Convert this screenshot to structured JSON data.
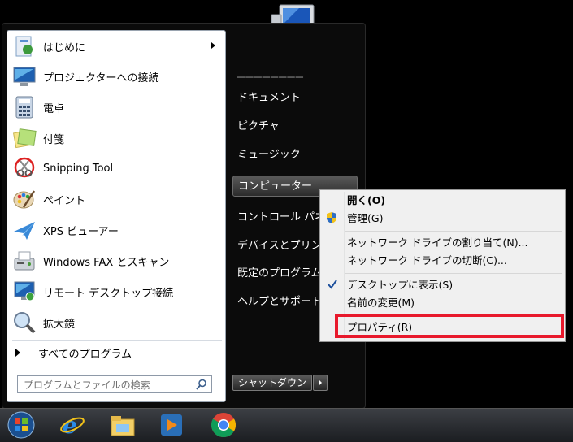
{
  "start_menu": {
    "programs": [
      {
        "label": "はじめに",
        "icon": "getting-started-icon",
        "submenu": true
      },
      {
        "label": "プロジェクターへの接続",
        "icon": "projector-icon"
      },
      {
        "label": "電卓",
        "icon": "calculator-icon"
      },
      {
        "label": "付箋",
        "icon": "sticky-notes-icon"
      },
      {
        "label": "Snipping Tool",
        "icon": "snipping-tool-icon"
      },
      {
        "label": "ペイント",
        "icon": "paint-palette-icon"
      },
      {
        "label": "XPS ビューアー",
        "icon": "xps-viewer-icon"
      },
      {
        "label": "Windows FAX とスキャン",
        "icon": "fax-scan-icon"
      },
      {
        "label": "リモート デスクトップ接続",
        "icon": "remote-desktop-icon"
      },
      {
        "label": "拡大鏡",
        "icon": "magnifier-icon"
      }
    ],
    "all_programs": "すべてのプログラム",
    "search_placeholder": "プログラムとファイルの検索",
    "right_pane": [
      "ドキュメント",
      "ピクチャ",
      "ミュージック",
      "コンピューター",
      "コントロール パネル",
      "デバイスとプリンター",
      "既定のプログラム",
      "ヘルプとサポート"
    ],
    "shutdown_label": "シャットダウン"
  },
  "context_menu": {
    "items": {
      "open": "開く(O)",
      "manage": "管理(G)",
      "map_drive": "ネットワーク ドライブの割り当て(N)...",
      "disconnect_drive": "ネットワーク ドライブの切断(C)...",
      "show_on_desktop": "デスクトップに表示(S)",
      "rename": "名前の変更(M)",
      "properties": "プロパティ(R)"
    }
  },
  "taskbar": {
    "icons": [
      "start-orb-icon",
      "internet-explorer-icon",
      "file-explorer-icon",
      "media-player-icon",
      "chrome-icon"
    ]
  },
  "colors": {
    "highlight": "#e8192c",
    "accent": "#1e5aa8"
  }
}
